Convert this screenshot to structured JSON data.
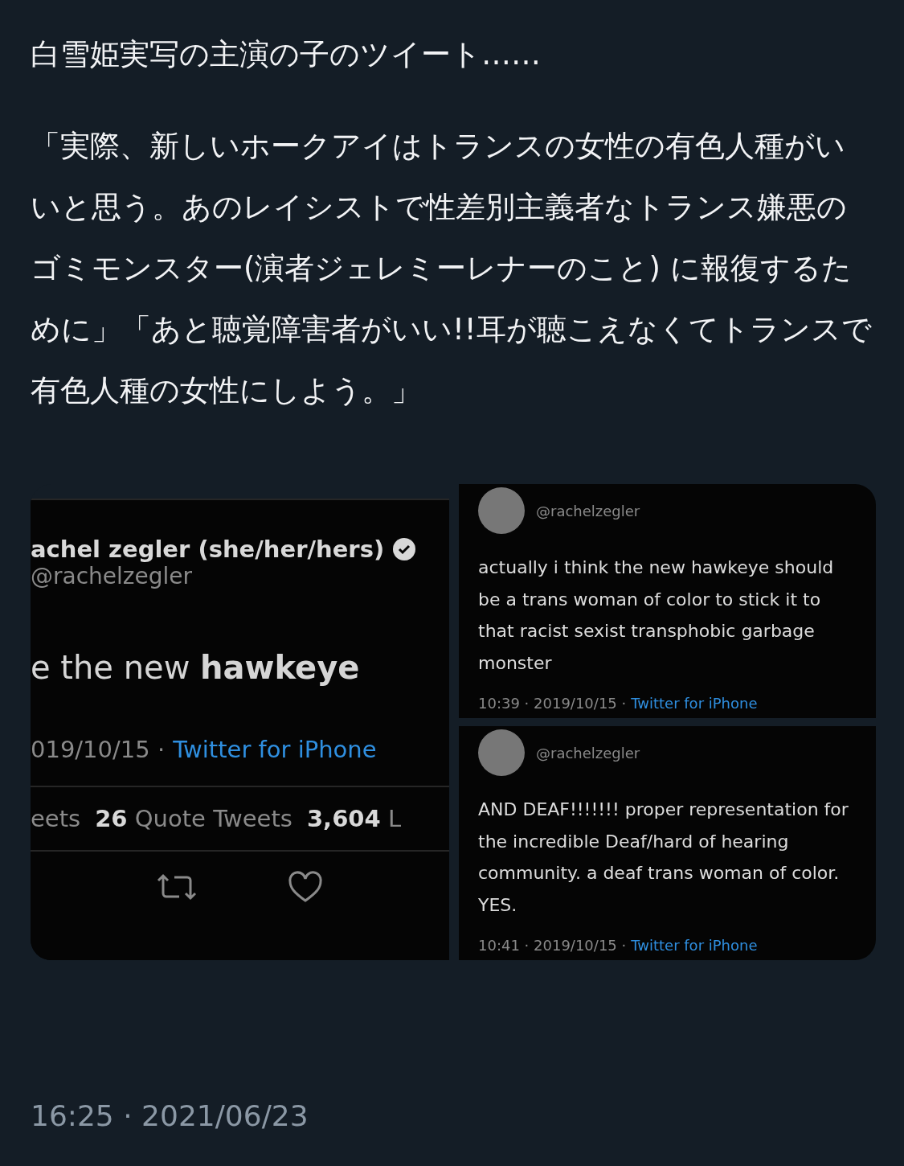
{
  "post": {
    "paragraphs": [
      "白雪姫実写の主演の子のツイート……",
      "「実際、新しいホークアイはトランスの女性の有色人種がいいと思う。あのレイシストで性差別主義者なトランス嫌悪のゴミモンスター(演者ジェレミーレナーのこと) に報復するために」「あと聴覚障害者がいい!!耳が聴こえなくてトランスで有色人種の女性にしよう。」"
    ],
    "timestamp": "16:25 · 2021/06/23"
  },
  "media": {
    "main": {
      "name": "achel zegler (she/her/hers)",
      "handle": "@rachelzegler",
      "body": "e the new **hawkeye**",
      "date": "019/10/15 ·",
      "source": "Twitter for iPhone",
      "stats": [
        "eets",
        "**26** Quote Tweets",
        "**3,604** L"
      ]
    },
    "side": [
      {
        "handle": "@rachelzegler",
        "body": "actually i think the new hawkeye should be a trans woman of color to stick it to that racist sexist transphobic garbage monster",
        "time": "10:39 · 2019/10/15 ·",
        "source": "Twitter for iPhone"
      },
      {
        "handle": "@rachelzegler",
        "body": "AND DEAF!!!!!!! proper representation for the incredible Deaf/hard of hearing community. a deaf trans woman of color. YES.",
        "time": "10:41 · 2019/10/15 ·",
        "source": "Twitter for iPhone"
      }
    ]
  }
}
